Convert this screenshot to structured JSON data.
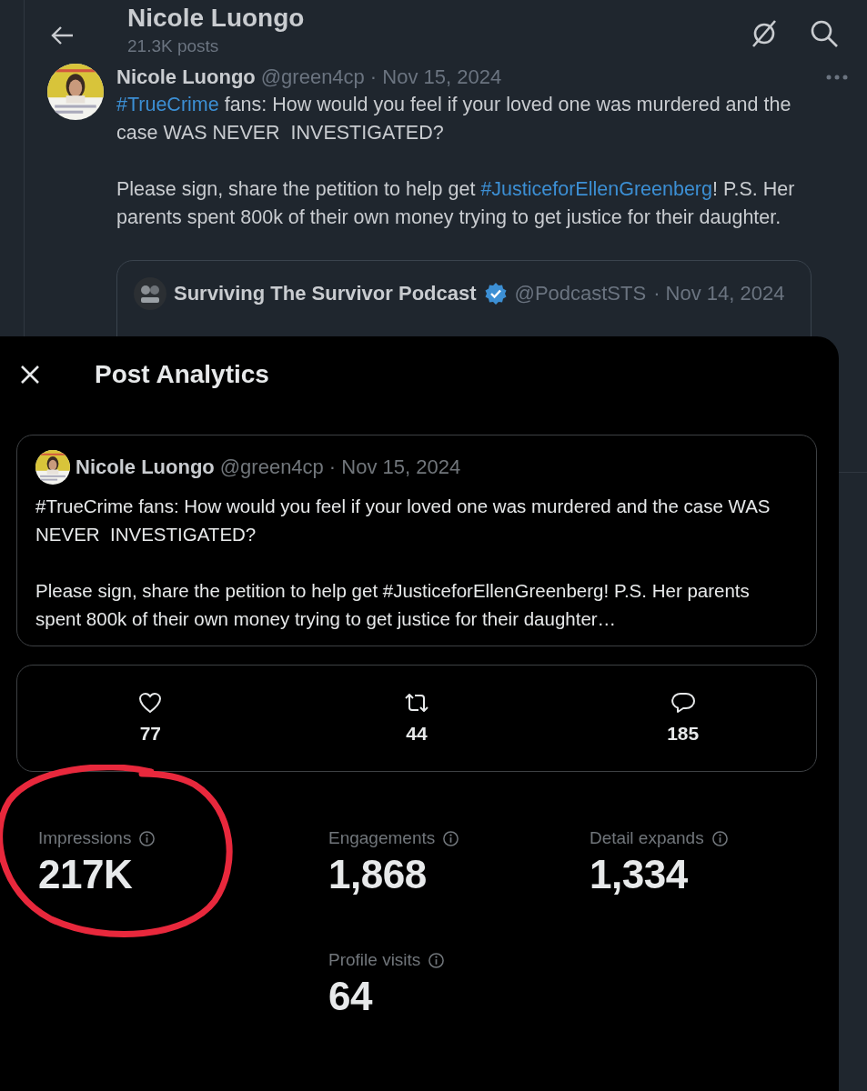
{
  "header": {
    "title": "Nicole Luongo",
    "subtitle": "21.3K posts"
  },
  "post": {
    "name": "Nicole Luongo",
    "handle": "@green4cp",
    "date": "· Nov 15, 2024",
    "paragraphs": [
      [
        {
          "kind": "hashtag",
          "text": "#TrueCrime"
        },
        {
          "kind": "text",
          "text": " fans: How would you feel if your loved one was murdered and the case WAS NEVER  INVESTIGATED?"
        }
      ],
      [
        {
          "kind": "text",
          "text": "Please sign, share the petition to help get "
        },
        {
          "kind": "hashtag",
          "text": "#JusticeforEllenGreenberg"
        },
        {
          "kind": "text",
          "text": "! P.S. Her parents spent 800k of their own money trying to get justice for their daughter."
        }
      ]
    ],
    "quote": {
      "name": "Surviving The Survivor Podcast",
      "verified": true,
      "handle": "@PodcastSTS",
      "date": "· Nov 14, 2024"
    }
  },
  "modal": {
    "title": "Post Analytics",
    "card": {
      "name": "Nicole Luongo",
      "handle": "@green4cp",
      "date": "· Nov 15, 2024",
      "paragraphs": [
        "#TrueCrime fans: How would you feel if your loved one was murdered and the case WAS NEVER  INVESTIGATED?",
        "Please sign, share the petition to help get #JusticeforEllenGreenberg! P.S. Her parents spent 800k of their own money trying to get justice for their daughter…"
      ]
    },
    "counts": [
      {
        "kind": "like",
        "value": "77"
      },
      {
        "kind": "repost",
        "value": "44"
      },
      {
        "kind": "reply",
        "value": "185"
      }
    ],
    "metrics": [
      {
        "label": "Impressions",
        "value": "217K",
        "circled": true
      },
      {
        "label": "Engagements",
        "value": "1,868",
        "circled": false
      },
      {
        "label": "Detail expands",
        "value": "1,334",
        "circled": false
      },
      {
        "label": "Profile visits",
        "value": "64",
        "circled": false
      }
    ]
  }
}
